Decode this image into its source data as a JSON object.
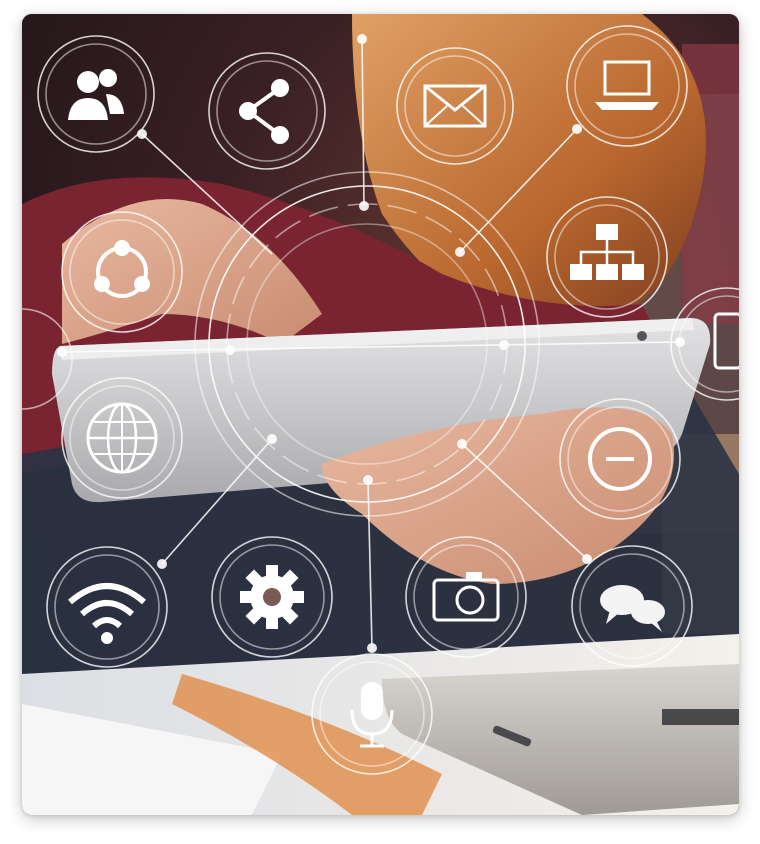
{
  "image": {
    "subject": "person-holding-tablet",
    "overlay_icons": [
      "users-icon",
      "share-icon",
      "mail-icon",
      "laptop-icon",
      "hierarchy-icon",
      "refresh-cycle-icon",
      "tablet-icon",
      "globe-icon",
      "minus-icon",
      "wifi-icon",
      "gear-icon",
      "camera-icon",
      "chat-icon",
      "microphone-icon"
    ],
    "colors": {
      "background_dark": "#2b1a1d",
      "sweater": "#7a2431",
      "hair": "#c9773a",
      "tablet": "#c9c9cb",
      "laptop": "#b9b6b2",
      "desk": "#ece8e2",
      "overlay_line": "#ffffff"
    }
  }
}
